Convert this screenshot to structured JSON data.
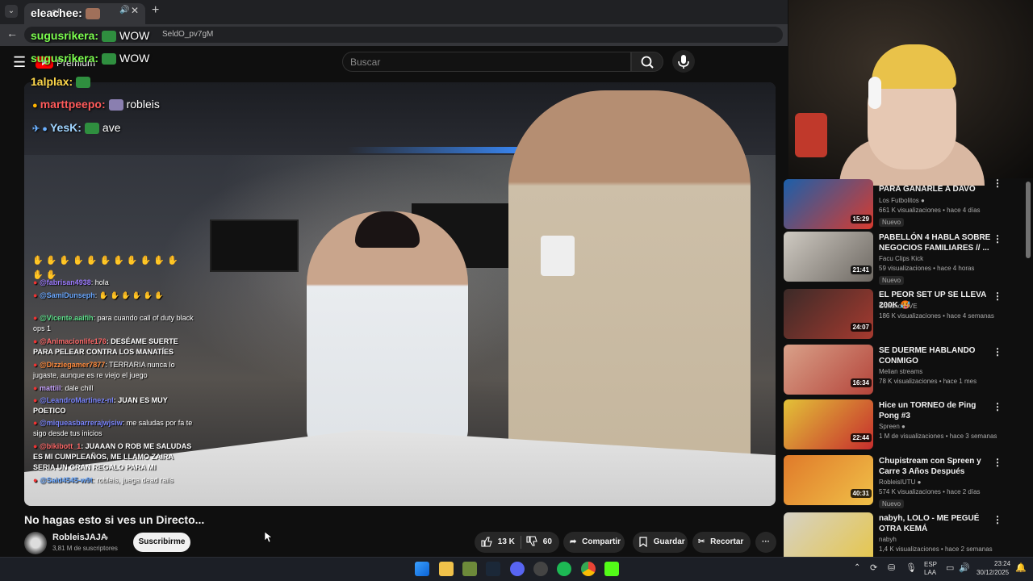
{
  "browser": {
    "tab_title": "aí",
    "url": "SeldO_pv7gM"
  },
  "youtube": {
    "logo_text": "Premium",
    "search_placeholder": "Buscar"
  },
  "chat_overlay": {
    "top_messages": [
      {
        "user": "eleachee:",
        "text": "",
        "color": "#ffffff"
      },
      {
        "user": "sugusrikera:",
        "text": "WOW",
        "color": "#7cff4f"
      },
      {
        "user": "sugusrikera:",
        "text": "WOW",
        "color": "#7cff4f"
      },
      {
        "user": "1alplax:",
        "text": "",
        "color": "#ffd84a"
      },
      {
        "user": "marttpeepo:",
        "text": "robleis",
        "color": "#ff5a5a"
      },
      {
        "user": "YesK:",
        "text": "ave",
        "color": "#9fd4ff"
      }
    ],
    "small_messages": [
      {
        "user": "@fabrisan4938",
        "text": ": hola",
        "color": "#9d7bff"
      },
      {
        "user": "@SamiDunseph",
        "text": ":",
        "color": "#6aa8ff"
      },
      {
        "user": "@Vicente.aaifih",
        "text": ": para cuando call of duty black ops 1",
        "color": "#5fe08c"
      },
      {
        "user": "@Animacionlife176",
        "text": ": DESÉAME SUERTE PARA PELEAR CONTRA LOS MANATÍES",
        "color": "#ff6a6a"
      },
      {
        "user": "@Dizziegamer7877",
        "text": ": TERRARIA nunca lo jugaste, aunque es re viejo el juego",
        "color": "#ff8a3c"
      },
      {
        "user": "mattiil",
        "text": ": dale chill",
        "color": "#c8a4ff"
      },
      {
        "user": "@LeandroMartinez-nl",
        "text": ": JUAN ES MUY POETICO",
        "color": "#7b86ff"
      },
      {
        "user": "@miqueasbarrerajwjsiw",
        "text": ": me saludas por fa te sigo desde tus inicios",
        "color": "#7b86ff"
      },
      {
        "user": "@bikibott_1",
        "text": ": JUAAAN O ROB ME SALUDAS ES MI CUMPLEAÑOS, ME LLAMO ZAIRA SERIA UN GRAN REGALO PARA MI",
        "color": "#ff6a6a"
      },
      {
        "user": "@Said4545-w9t",
        "text": ": robleis, juega dead rails",
        "color": "#6aa8ff"
      }
    ]
  },
  "video": {
    "title": "No hagas esto si ves un Directo...",
    "channel": "RobleisJAJA",
    "subscribers": "3,81 M de suscriptores",
    "subscribe_label": "Suscribirme",
    "likes": "13 K",
    "dislikes": "60",
    "share_label": "Compartir",
    "save_label": "Guardar",
    "clip_label": "Recortar",
    "more_label": "···"
  },
  "recommendations": [
    {
      "title": "PARA GANARLE A DAVO",
      "channel": "Los Futbolitos",
      "verified": true,
      "meta": "661 K visualizaciones • hace 4 días",
      "badge": "Nuevo",
      "duration": "15:29",
      "colors": [
        "#1b5faa",
        "#d83b2f"
      ]
    },
    {
      "title": "PABELLÓN 4 HABLA SOBRE NEGOCIOS FAMILIARES // ...",
      "channel": "Facu Clips Kick",
      "verified": false,
      "meta": "59 visualizaciones • hace 4 horas",
      "badge": "Nuevo",
      "duration": "21:41",
      "colors": [
        "#cfcac2",
        "#6d6862"
      ]
    },
    {
      "title": "EL PEOR SET UP SE LLEVA 200K 🥵",
      "channel": "Goncho LIVE",
      "verified": false,
      "meta": "186 K visualizaciones • hace 4 semanas",
      "badge": "",
      "duration": "24:07",
      "colors": [
        "#3b2a28",
        "#a63a2f"
      ]
    },
    {
      "title": "SE DUERME HABLANDO CONMIGO",
      "channel": "Melian streams",
      "verified": false,
      "meta": "78 K visualizaciones • hace 1 mes",
      "badge": "",
      "duration": "16:34",
      "colors": [
        "#d9a189",
        "#b4443a"
      ]
    },
    {
      "title": "Hice un TORNEO de Ping Pong #3",
      "channel": "Spreen",
      "verified": true,
      "meta": "1 M de visualizaciones • hace 3 semanas",
      "badge": "",
      "duration": "22:44",
      "colors": [
        "#e3c238",
        "#c62d2d"
      ]
    },
    {
      "title": "Chupistream con Spreen y Carre 3 Años Después",
      "channel": "RobleisIUTU",
      "verified": true,
      "meta": "574 K visualizaciones • hace 2 días",
      "badge": "Nuevo",
      "duration": "40:31",
      "colors": [
        "#e07a2a",
        "#f0c048"
      ]
    },
    {
      "title": "nabyh, LOLO - ME PEGUÉ OTRA KEMÁ",
      "channel": "nabyh",
      "verified": false,
      "meta": "1,4 K visualizaciones • hace 2 semanas",
      "badge": "",
      "duration": "",
      "colors": [
        "#d6d2c6",
        "#e6c64a"
      ]
    }
  ],
  "taskbar": {
    "lang_top": "ESP",
    "lang_bottom": "LAA",
    "time": "23:24",
    "date": "30/12/2025"
  }
}
